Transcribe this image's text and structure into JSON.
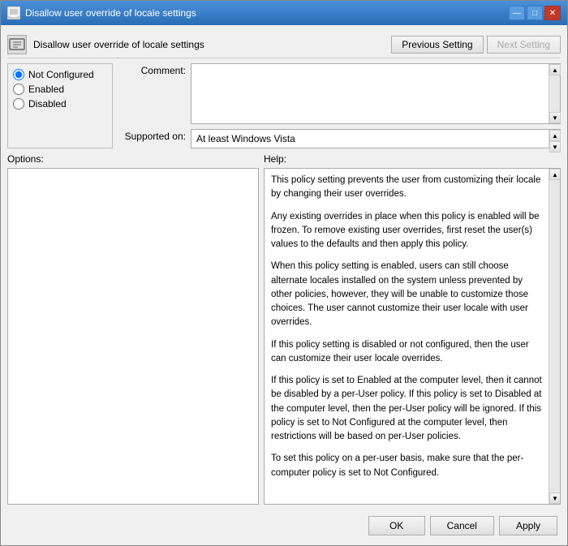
{
  "window": {
    "title": "Disallow user override of locale settings",
    "icon": "⚙"
  },
  "header": {
    "title": "Disallow user override of locale settings",
    "previous_button": "Previous Setting",
    "next_button": "Next Setting"
  },
  "radio_options": {
    "not_configured": "Not Configured",
    "enabled": "Enabled",
    "disabled": "Disabled",
    "selected": "not_configured"
  },
  "comment_label": "Comment:",
  "comment_value": "",
  "supported_label": "Supported on:",
  "supported_value": "At least Windows Vista",
  "options_label": "Options:",
  "help_label": "Help:",
  "help_text": [
    "This policy setting prevents the user from customizing their locale by changing their user overrides.",
    "Any existing overrides in place when this policy is enabled will be frozen. To remove existing user overrides, first reset the user(s) values to the defaults and then apply this policy.",
    "When this policy setting is enabled, users can still choose alternate locales installed on the system unless prevented by other policies, however, they will be unable to customize those choices.  The user cannot customize their user locale with user overrides.",
    "If this policy setting is disabled or not configured, then the user can customize their user locale overrides.",
    "If this policy is set to Enabled at the computer level, then it cannot be disabled by a per-User policy. If this policy is set to Disabled at the computer level, then the per-User policy will be ignored. If this policy is set to Not Configured at the computer level, then restrictions will be based on per-User policies.",
    "To set this policy on a per-user basis, make sure that the per-computer policy is set to Not Configured."
  ],
  "footer": {
    "ok_label": "OK",
    "cancel_label": "Cancel",
    "apply_label": "Apply"
  },
  "titlebar_buttons": {
    "minimize": "—",
    "maximize": "□",
    "close": "✕"
  }
}
